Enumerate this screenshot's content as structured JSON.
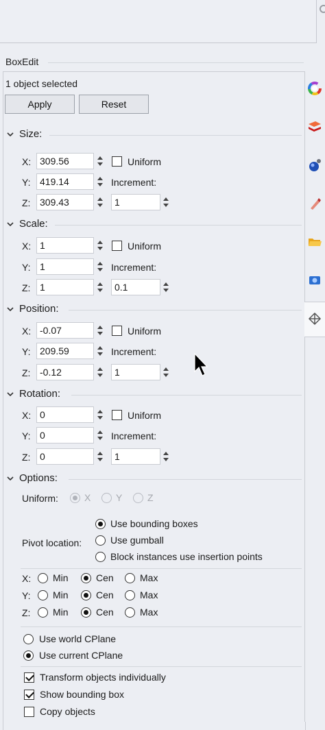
{
  "panel": {
    "title": "BoxEdit"
  },
  "selection_status": "1 object selected",
  "buttons": {
    "apply": "Apply",
    "reset": "Reset"
  },
  "common": {
    "x": "X:",
    "y": "Y:",
    "z": "Z:",
    "uniform": "Uniform",
    "increment": "Increment:"
  },
  "size": {
    "title": "Size:",
    "x": "309.56",
    "y": "419.14",
    "z": "309.43",
    "increment": "1",
    "uniform": false
  },
  "scale": {
    "title": "Scale:",
    "x": "1",
    "y": "1",
    "z": "1",
    "increment": "0.1",
    "uniform": false
  },
  "position": {
    "title": "Position:",
    "x": "-0.07",
    "y": "209.59",
    "z": "-0.12",
    "increment": "1",
    "uniform": false
  },
  "rotation": {
    "title": "Rotation:",
    "x": "0",
    "y": "0",
    "z": "0",
    "increment": "1",
    "uniform": false
  },
  "options": {
    "title": "Options:",
    "uniform_label": "Uniform:",
    "uniform_axes": [
      "X",
      "Y",
      "Z"
    ],
    "uniform_selected": "X",
    "pivot_label": "Pivot location:",
    "pivot_choices": [
      "Use bounding boxes",
      "Use gumball",
      "Block instances use insertion points"
    ],
    "pivot_selected": "Use bounding boxes",
    "axis_choices": [
      "Min",
      "Cen",
      "Max"
    ],
    "axis_selected": {
      "x": "Cen",
      "y": "Cen",
      "z": "Cen"
    },
    "cplane_choices": [
      "Use world CPlane",
      "Use current CPlane"
    ],
    "cplane_selected": "Use current CPlane",
    "checks": [
      {
        "label": "Transform objects individually",
        "checked": true
      },
      {
        "label": "Show bounding box",
        "checked": true
      },
      {
        "label": "Copy objects",
        "checked": false
      }
    ]
  },
  "sidebar_tabs": [
    "color-wheel-icon",
    "layer-icon",
    "material-sphere-icon",
    "pen-icon",
    "folder-icon",
    "display-icon",
    "boxedit-gumball-icon"
  ]
}
